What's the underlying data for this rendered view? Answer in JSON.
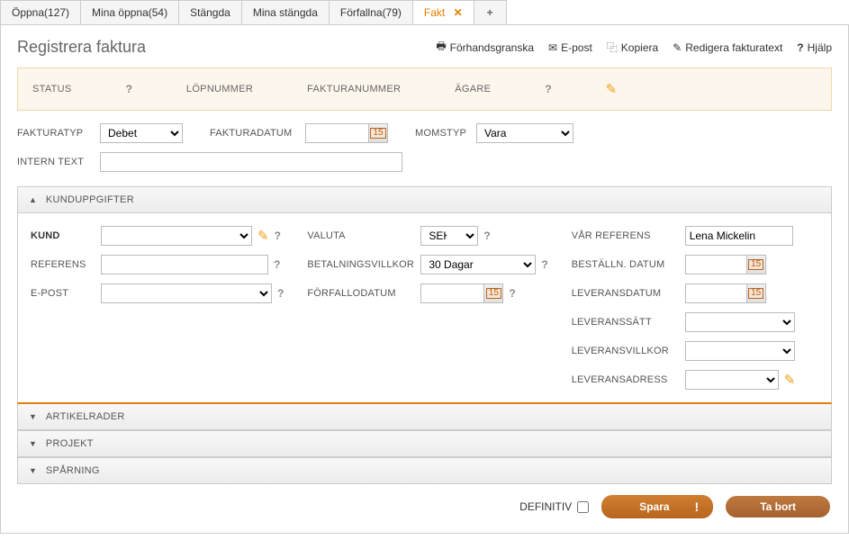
{
  "tabs": [
    {
      "label": "Öppna(127)"
    },
    {
      "label": "Mina öppna(54)"
    },
    {
      "label": "Stängda"
    },
    {
      "label": "Mina stängda"
    },
    {
      "label": "Förfallna(79)"
    },
    {
      "label": "Fakt",
      "active": true
    }
  ],
  "page_title": "Registrera faktura",
  "toolbar": {
    "preview": "Förhandsgranska",
    "email": "E-post",
    "copy": "Kopiera",
    "edit_text": "Redigera fakturatext",
    "help": "Hjälp"
  },
  "status": {
    "status_label": "STATUS",
    "lopnummer": "LÖPNUMMER",
    "fakturanummer": "FAKTURANUMMER",
    "agare": "ÄGARE"
  },
  "top_fields": {
    "fakturatyp_label": "FAKTURATYP",
    "fakturatyp_value": "Debet",
    "fakturadatum_label": "FAKTURADATUM",
    "momstyp_label": "MOMSTYP",
    "momstyp_value": "Vara",
    "intern_text_label": "INTERN TEXT"
  },
  "sections": {
    "kund": "KUNDUPPGIFTER",
    "artikel": "ARTIKELRADER",
    "projekt": "PROJEKT",
    "sparning": "SPÅRNING"
  },
  "kund_fields": {
    "kund": "KUND",
    "referens": "REFERENS",
    "epost": "E-POST",
    "valuta": "VALUTA",
    "valuta_value": "SEK",
    "betalningsvillkor": "BETALNINGSVILLKOR",
    "betalningsvillkor_value": "30 Dagar",
    "forfallodatum": "FÖRFALLODATUM",
    "var_referens": "VÅR REFERENS",
    "var_referens_value": "Lena Mickelin",
    "bestalln_datum": "BESTÄLLN. DATUM",
    "leveransdatum": "LEVERANSDATUM",
    "leveranssatt": "LEVERANSSÄTT",
    "leveransvillkor": "LEVERANSVILLKOR",
    "leveransadress": "LEVERANSADRESS"
  },
  "footer": {
    "definitiv": "DEFINITIV",
    "save": "Spara",
    "delete": "Ta bort"
  }
}
